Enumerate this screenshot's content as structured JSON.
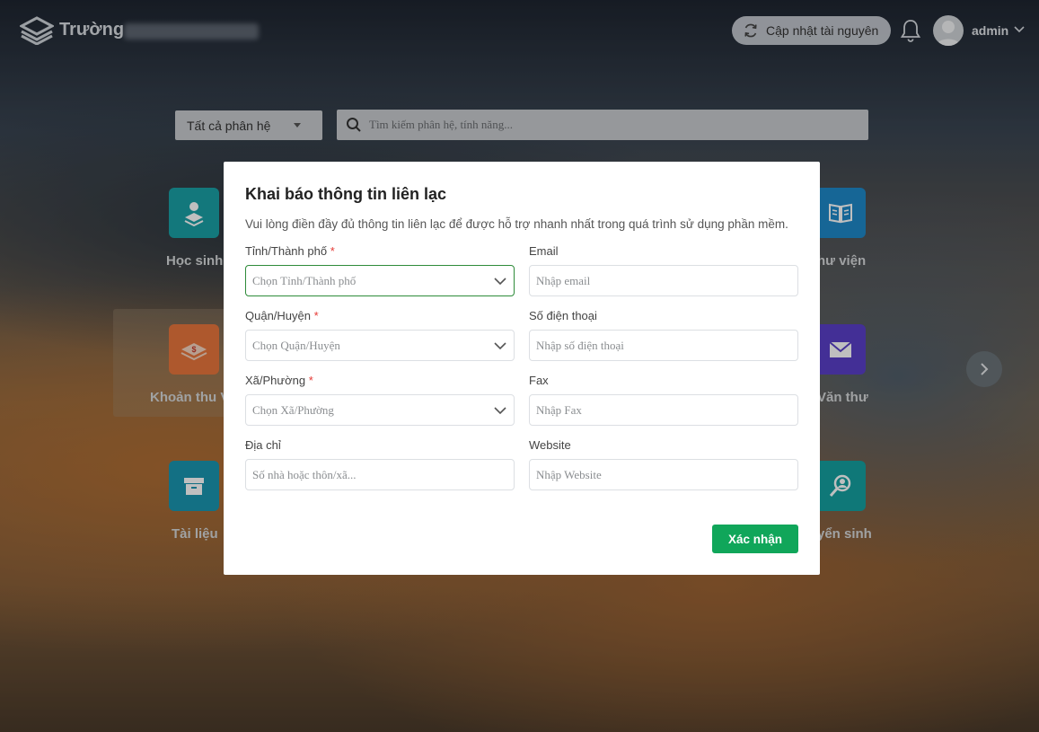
{
  "header": {
    "school_name": "Trường",
    "update_button": "Cập nhật tài nguyên",
    "user_name": "admin"
  },
  "search": {
    "module_select": "Tất cả phân hệ",
    "placeholder": "Tìm kiếm phân hệ, tính năng..."
  },
  "tiles": [
    {
      "label": "Học sinh",
      "icon": "student-icon",
      "color": "#1aa0a6"
    },
    {
      "label": "hư viện",
      "icon": "book-icon",
      "color": "#1e88c8"
    },
    {
      "label": "Khoản thu V",
      "icon": "money-icon",
      "color": "#e8763c"
    },
    {
      "label": "Văn thư",
      "icon": "mail-icon",
      "color": "#5a3fc8"
    },
    {
      "label": "Tài liệu",
      "icon": "archive-icon",
      "color": "#1a96b0"
    },
    {
      "label": "yển sinh",
      "icon": "user-search-icon",
      "color": "#14a0a0"
    }
  ],
  "modal": {
    "title": "Khai báo thông tin liên lạc",
    "description": "Vui lòng điền đầy đủ thông tin liên lạc để được hỗ trợ nhanh nhất trong quá trình sử dụng phần mềm.",
    "province_label": "Tỉnh/Thành phố",
    "province_placeholder": "Chọn Tỉnh/Thành phố",
    "district_label": "Quận/Huyện",
    "district_placeholder": "Chọn Quận/Huyện",
    "ward_label": "Xã/Phường",
    "ward_placeholder": "Chọn Xã/Phường",
    "address_label": "Địa chỉ",
    "address_placeholder": "Số nhà hoặc thôn/xã...",
    "email_label": "Email",
    "email_placeholder": "Nhập email",
    "phone_label": "Số điện thoại",
    "phone_placeholder": "Nhập số điện thoại",
    "fax_label": "Fax",
    "fax_placeholder": "Nhập Fax",
    "website_label": "Website",
    "website_placeholder": "Nhập Website",
    "required_mark": "*",
    "confirm_button": "Xác nhận"
  },
  "colors": {
    "primary_green": "#10a65a",
    "focus_border": "#2e8b3a",
    "required": "#e53935"
  }
}
